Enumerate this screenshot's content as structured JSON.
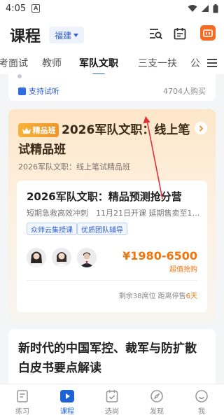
{
  "status_bar": {
    "time": "4:05",
    "notification": "A"
  },
  "header": {
    "title": "课程",
    "region": "福建"
  },
  "tabs": [
    {
      "label": "考面试",
      "active": false
    },
    {
      "label": "教师",
      "active": false
    },
    {
      "label": "军队文职",
      "active": true
    },
    {
      "label": "三支一扶",
      "active": false
    },
    {
      "label": "公",
      "active": false
    }
  ],
  "prev_card": {
    "badge": "支持试听",
    "buyers": "4704人购买"
  },
  "course_card": {
    "badge": "精品班",
    "title": "2026军队文职：线上笔试精品班",
    "subtitle": "2026军队文职：线上笔试精品班",
    "inner": {
      "title": "2026军队文职：精品预测抢分营",
      "description": "短期急救高效冲刺　11月21日开课 延期售卖至12...",
      "tags": [
        "众师云集授课",
        "优质团队辅导"
      ],
      "teachers": [
        "teacher-1",
        "teacher-2",
        "teacher-3"
      ],
      "price": "¥1980-6500",
      "price_note": "超值抢购",
      "seats_text": "剩余38席位  距离停售",
      "seats_days": "6天"
    }
  },
  "article_card": {
    "title": "新时代的中国军控、裁军与防扩散白皮书要点解读"
  },
  "bottom_nav": [
    {
      "label": "练习",
      "icon": "practice-icon",
      "active": false
    },
    {
      "label": "课程",
      "icon": "course-play-icon",
      "active": true
    },
    {
      "label": "选岗",
      "icon": "position-select-icon",
      "active": false
    },
    {
      "label": "发现",
      "icon": "compass-icon",
      "active": false
    },
    {
      "label": "我",
      "icon": "profile-icon",
      "active": false
    }
  ],
  "colors": {
    "accent": "#1e63d6",
    "price": "#f0740f",
    "live": "#f36c23",
    "premium": "#f0952a"
  }
}
